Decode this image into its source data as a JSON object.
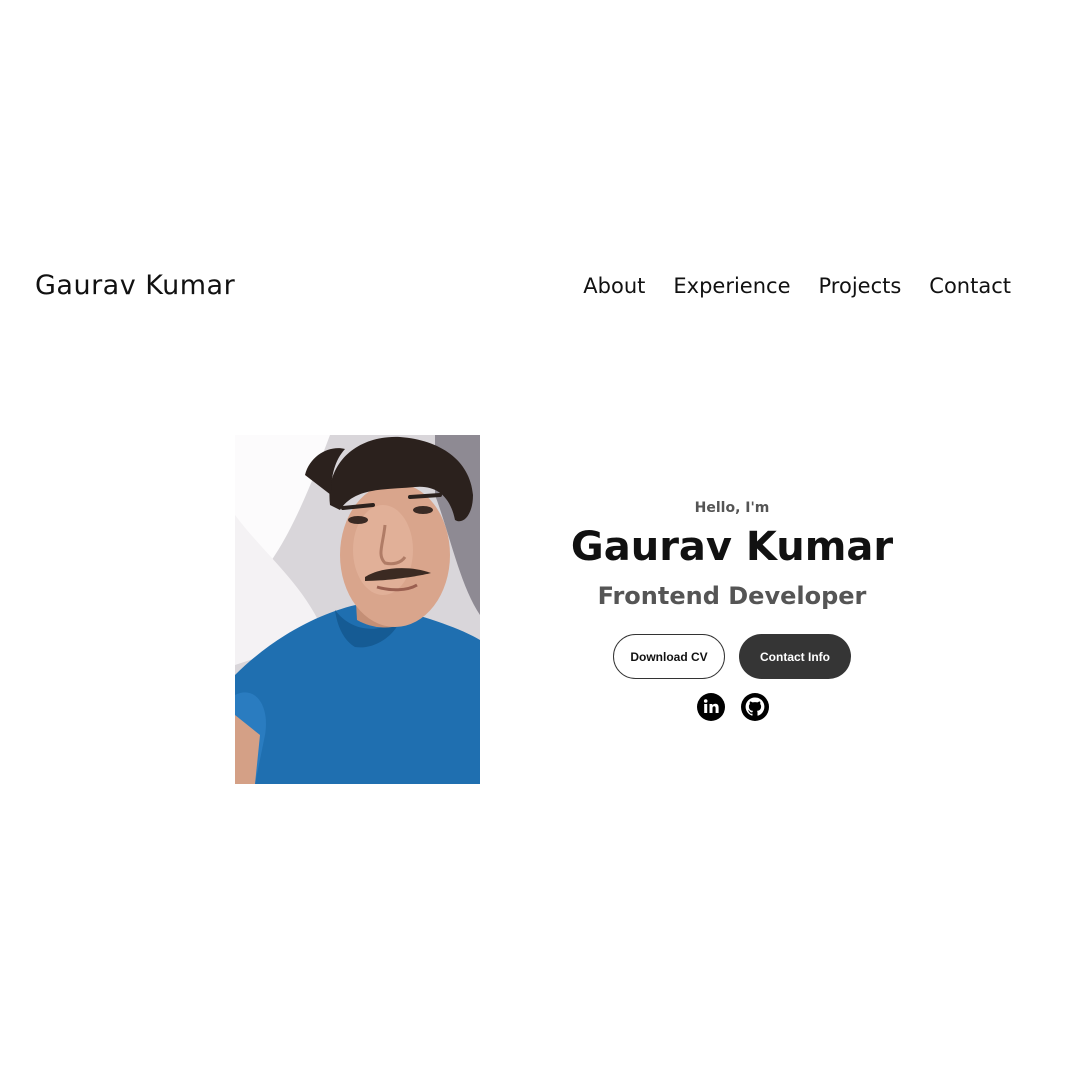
{
  "nav": {
    "logo": "Gaurav Kumar",
    "links": [
      "About",
      "Experience",
      "Projects",
      "Contact"
    ]
  },
  "hero": {
    "greeting": "Hello, I'm",
    "name": "Gaurav Kumar",
    "role": "Frontend Developer",
    "buttons": {
      "download": "Download CV",
      "contact": "Contact Info"
    },
    "socials": [
      "linkedin-icon",
      "github-icon"
    ]
  },
  "colors": {
    "primary_button": "#353535",
    "text_dark": "#111111",
    "text_muted": "#555555"
  }
}
